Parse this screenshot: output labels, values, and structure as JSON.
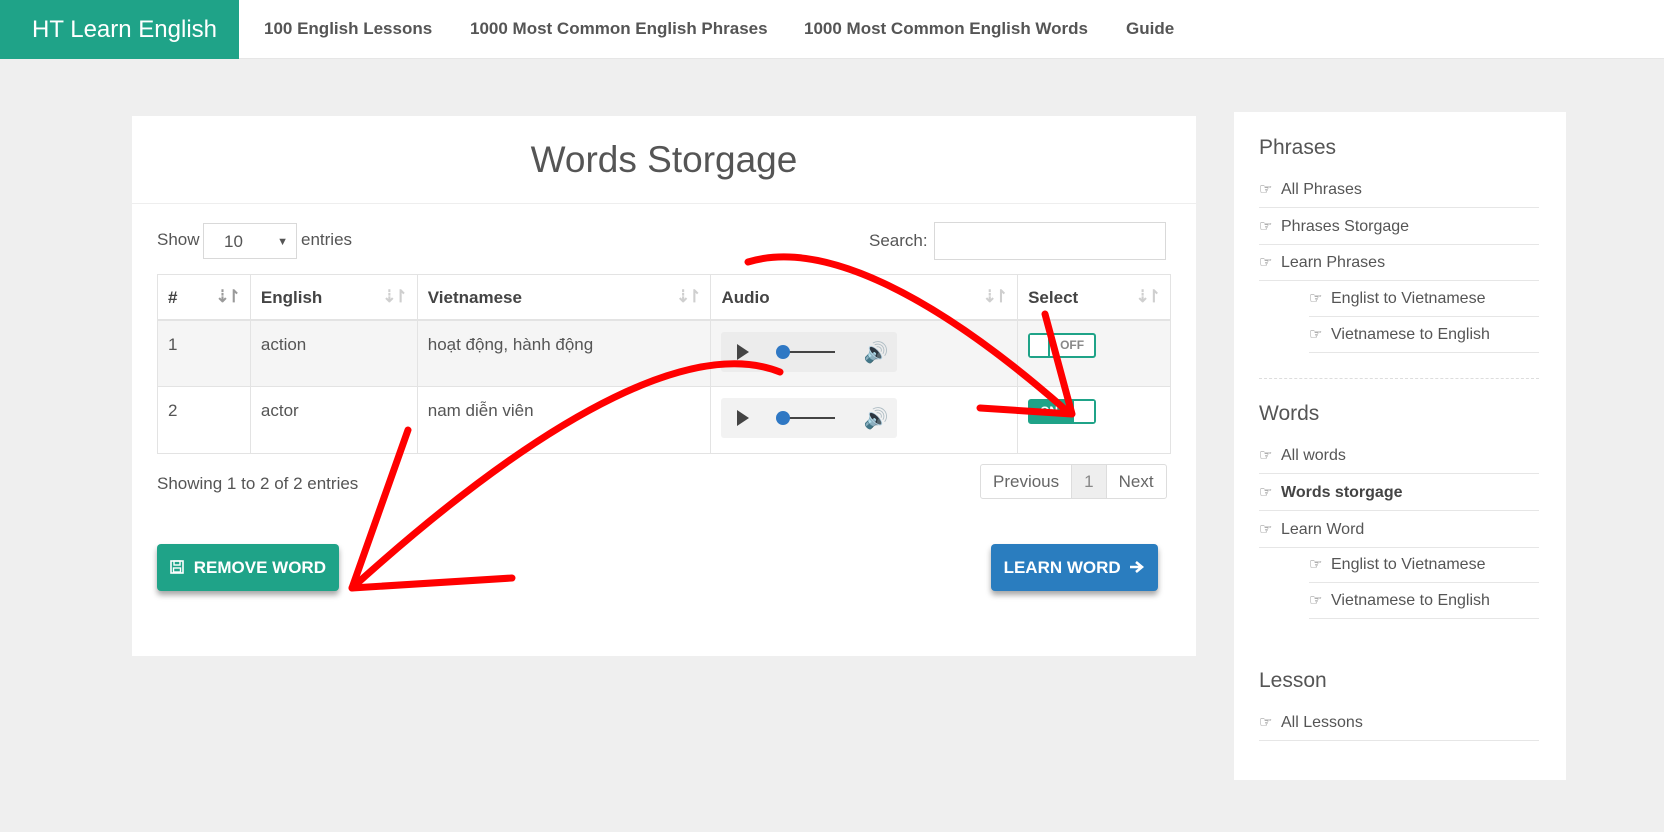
{
  "navbar": {
    "brand": "HT Learn English",
    "links": [
      "100 English Lessons",
      "1000 Most Common English Phrases",
      "1000 Most Common English Words",
      "Guide"
    ]
  },
  "main": {
    "title": "Words Storgage",
    "length": {
      "show": "Show",
      "value": "10",
      "entries": "entries"
    },
    "search": {
      "label": "Search:",
      "value": ""
    },
    "table": {
      "headers": [
        "#",
        "English",
        "Vietnamese",
        "Audio",
        "Select"
      ],
      "rows": [
        {
          "num": "1",
          "english": "action",
          "vietnamese": "hoạt động, hành động",
          "select": "OFF"
        },
        {
          "num": "2",
          "english": "actor",
          "vietnamese": "nam diễn viên",
          "select": "ON"
        }
      ]
    },
    "info": "Showing 1 to 2 of 2 entries",
    "pagination": {
      "previous": "Previous",
      "current": "1",
      "next": "Next"
    },
    "buttons": {
      "remove": "REMOVE WORD",
      "learn": "LEARN WORD"
    },
    "icons": {
      "save": "floppy-disk-icon",
      "arrow": "arrow-right-icon",
      "play": "play-icon",
      "volume": "volume-icon",
      "sort": "sort-icon"
    }
  },
  "sidebar": {
    "sections": [
      {
        "heading": "Phrases",
        "items": [
          {
            "label": "All Phrases",
            "sub": false
          },
          {
            "label": "Phrases Storgage",
            "sub": false
          },
          {
            "label": "Learn Phrases",
            "sub": false
          },
          {
            "label": "Englist to Vietnamese",
            "sub": true
          },
          {
            "label": "Vietnamese to English",
            "sub": true
          }
        ]
      },
      {
        "heading": "Words",
        "items": [
          {
            "label": "All words",
            "sub": false
          },
          {
            "label": "Words storgage",
            "sub": false,
            "active": true
          },
          {
            "label": "Learn Word",
            "sub": false
          },
          {
            "label": "Englist to Vietnamese",
            "sub": true
          },
          {
            "label": "Vietnamese to English",
            "sub": true
          }
        ]
      },
      {
        "heading": "Lesson",
        "items": [
          {
            "label": "All Lessons",
            "sub": false
          }
        ]
      }
    ]
  },
  "colors": {
    "brand": "#1fa388",
    "primary": "#2a7dbf",
    "annotation": "#ff0000"
  }
}
